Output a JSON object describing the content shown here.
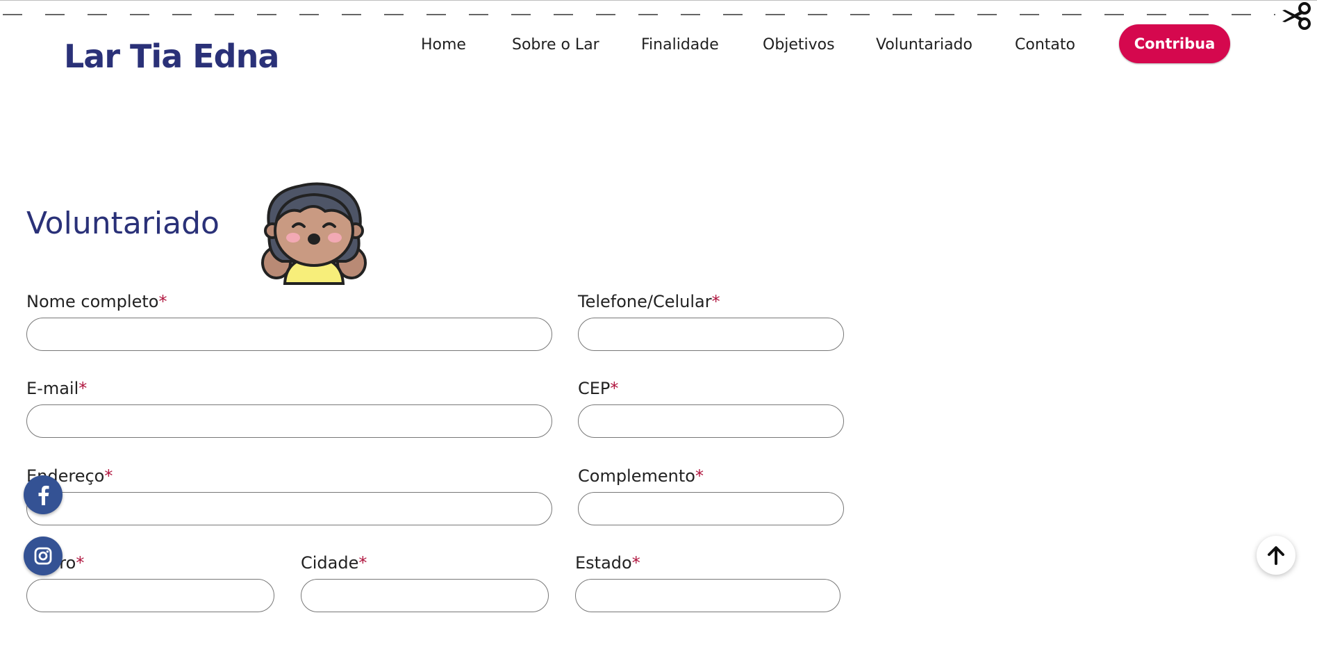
{
  "header": {
    "logo": "Lar Tia Edna",
    "nav": [
      "Home",
      "Sobre o Lar",
      "Finalidade",
      "Objetivos",
      "Voluntariado",
      "Contato"
    ],
    "cta_label": "Contribua"
  },
  "main": {
    "title": "Voluntariado",
    "required_mark": "*",
    "fields": {
      "nome": "Nome completo",
      "telefone": "Telefone/Celular",
      "email": "E-mail",
      "cep": "CEP",
      "endereco": "Endereço",
      "complemento": "Complemento",
      "bairro": "Bairro",
      "cidade": "Cidade",
      "estado": "Estado"
    }
  },
  "floating": {
    "social": [
      "facebook-icon",
      "instagram-icon"
    ],
    "back_to_top": "arrow-up-icon"
  },
  "colors": {
    "brand_navy": "#2a3178",
    "cta": "#d5084e",
    "required": "#b0163f",
    "social_bg": "#345294"
  }
}
